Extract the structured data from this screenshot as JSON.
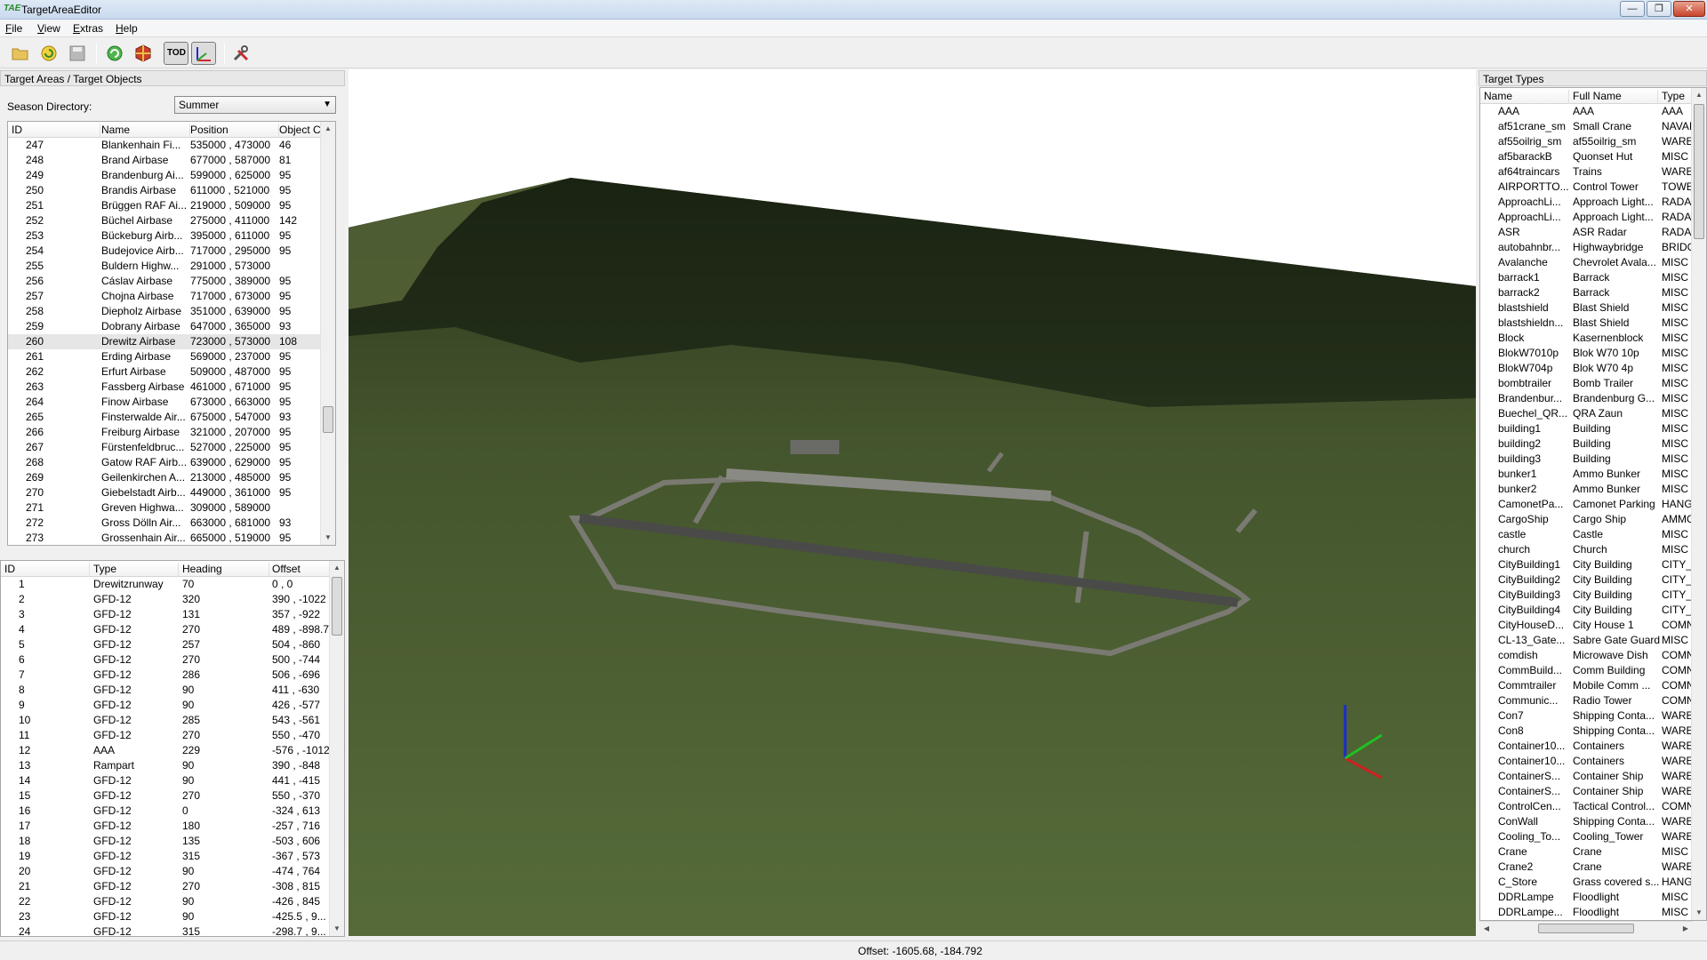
{
  "window": {
    "app_icon_text": "TAE",
    "title": "TargetAreaEditor",
    "minimize": "—",
    "maximize": "❐",
    "close": "✕"
  },
  "menu": [
    {
      "accel": "F",
      "rest": "ile"
    },
    {
      "accel": "V",
      "rest": "iew"
    },
    {
      "accel": "E",
      "rest": "xtras"
    },
    {
      "accel": "H",
      "rest": "elp"
    }
  ],
  "toolbar": {
    "open_icon": "folder-open-icon",
    "reload_icon": "reload-icon",
    "save_icon": "save-icon",
    "refresh_icon": "refresh-icon",
    "objects_icon": "cube-icon",
    "tod_label": "TOD",
    "axes_icon": "axes-icon",
    "tools_icon": "tools-icon"
  },
  "left_panel": {
    "header": "Target Areas / Target Objects",
    "season_label": "Season Directory:",
    "season_value": "Summer",
    "areas_columns": [
      "ID",
      "Name",
      "Position",
      "Object C"
    ],
    "areas": [
      [
        "247",
        "Blankenhain  Fi...",
        "535000 , 473000",
        "46"
      ],
      [
        "248",
        "Brand Airbase",
        "677000 , 587000",
        "81"
      ],
      [
        "249",
        "Brandenburg Ai...",
        "599000 , 625000",
        "95"
      ],
      [
        "250",
        "Brandis Airbase",
        "611000 , 521000",
        "95"
      ],
      [
        "251",
        "Brüggen RAF Ai...",
        "219000 , 509000",
        "95"
      ],
      [
        "252",
        "Büchel Airbase",
        "275000 , 411000",
        "142"
      ],
      [
        "253",
        "Bückeburg Airb...",
        "395000 , 611000",
        "95"
      ],
      [
        "254",
        "Budejovice Airb...",
        "717000 , 295000",
        "95"
      ],
      [
        "255",
        "Buldern Highw...",
        "291000 , 573000",
        ""
      ],
      [
        "256",
        "Cáslav Airbase",
        "775000 , 389000",
        "95"
      ],
      [
        "257",
        "Chojna Airbase",
        "717000 , 673000",
        "95"
      ],
      [
        "258",
        "Diepholz Airbase",
        "351000 , 639000",
        "95"
      ],
      [
        "259",
        "Dobrany Airbase",
        "647000 , 365000",
        "93"
      ],
      [
        "260",
        "Drewitz Airbase",
        "723000 , 573000",
        "108"
      ],
      [
        "261",
        "Erding Airbase",
        "569000 , 237000",
        "95"
      ],
      [
        "262",
        "Erfurt Airbase",
        "509000 , 487000",
        "95"
      ],
      [
        "263",
        "Fassberg Airbase",
        "461000 , 671000",
        "95"
      ],
      [
        "264",
        "Finow Airbase",
        "673000 , 663000",
        "95"
      ],
      [
        "265",
        "Finsterwalde Air...",
        "675000 , 547000",
        "93"
      ],
      [
        "266",
        "Freiburg Airbase",
        "321000 , 207000",
        "95"
      ],
      [
        "267",
        "Fürstenfeldbruc...",
        "527000 , 225000",
        "95"
      ],
      [
        "268",
        "Gatow RAF Airb...",
        "639000 , 629000",
        "95"
      ],
      [
        "269",
        "Geilenkirchen A...",
        "213000 , 485000",
        "95"
      ],
      [
        "270",
        "Giebelstadt Airb...",
        "449000 , 361000",
        "95"
      ],
      [
        "271",
        "Greven Highwa...",
        "309000 , 589000",
        ""
      ],
      [
        "272",
        "Gross Dölln Air...",
        "663000 , 681000",
        "93"
      ],
      [
        "273",
        "Grossenhain Air...",
        "665000 , 519000",
        "95"
      ]
    ],
    "objects_columns": [
      "ID",
      "Type",
      "Heading",
      "Offset"
    ],
    "objects": [
      [
        "1",
        "Drewitzrunway",
        "70",
        "0 , 0"
      ],
      [
        "2",
        "GFD-12",
        "320",
        "390 , -1022"
      ],
      [
        "3",
        "GFD-12",
        "131",
        "357 , -922"
      ],
      [
        "4",
        "GFD-12",
        "270",
        "489 , -898.7"
      ],
      [
        "5",
        "GFD-12",
        "257",
        "504 , -860"
      ],
      [
        "6",
        "GFD-12",
        "270",
        "500 , -744"
      ],
      [
        "7",
        "GFD-12",
        "286",
        "506 , -696"
      ],
      [
        "8",
        "GFD-12",
        "90",
        "411 , -630"
      ],
      [
        "9",
        "GFD-12",
        "90",
        "426 , -577"
      ],
      [
        "10",
        "GFD-12",
        "285",
        "543 , -561"
      ],
      [
        "11",
        "GFD-12",
        "270",
        "550 , -470"
      ],
      [
        "12",
        "AAA",
        "229",
        "-576 , -1012"
      ],
      [
        "13",
        "Rampart",
        "90",
        "390 , -848"
      ],
      [
        "14",
        "GFD-12",
        "90",
        "441 , -415"
      ],
      [
        "15",
        "GFD-12",
        "270",
        "550 , -370"
      ],
      [
        "16",
        "GFD-12",
        "0",
        "-324 , 613"
      ],
      [
        "17",
        "GFD-12",
        "180",
        "-257 , 716"
      ],
      [
        "18",
        "GFD-12",
        "135",
        "-503 , 606"
      ],
      [
        "19",
        "GFD-12",
        "315",
        "-367 , 573"
      ],
      [
        "20",
        "GFD-12",
        "90",
        "-474 , 764"
      ],
      [
        "21",
        "GFD-12",
        "270",
        "-308 , 815"
      ],
      [
        "22",
        "GFD-12",
        "90",
        "-426 , 845"
      ],
      [
        "23",
        "GFD-12",
        "90",
        "-425.5 , 9..."
      ],
      [
        "24",
        "GFD-12",
        "315",
        "-298.7 , 9..."
      ]
    ]
  },
  "right_panel": {
    "header": "Target Types",
    "columns": [
      "Name",
      "Full Name",
      "Type"
    ],
    "types": [
      [
        "AAA",
        "AAA",
        "AAA"
      ],
      [
        "af51crane_sm",
        "Small Crane",
        "NAVAI"
      ],
      [
        "af55oilrig_sm",
        "af55oilrig_sm",
        "WAREI"
      ],
      [
        "af5barackB",
        "Quonset Hut",
        "MISC"
      ],
      [
        "af64traincars",
        "Trains",
        "WAREI"
      ],
      [
        "AIRPORTTO...",
        "Control Tower",
        "TOWE"
      ],
      [
        "ApproachLi...",
        "Approach Light...",
        "RADAI"
      ],
      [
        "ApproachLi...",
        "Approach Light...",
        "RADAI"
      ],
      [
        "ASR",
        "ASR Radar",
        "RADAI"
      ],
      [
        "autobahnbr...",
        "Highwaybridge",
        "BRIDG"
      ],
      [
        "Avalanche",
        "Chevrolet Avala...",
        "MISC"
      ],
      [
        "barrack1",
        "Barrack",
        "MISC"
      ],
      [
        "barrack2",
        "Barrack",
        "MISC"
      ],
      [
        "blastshield",
        "Blast Shield",
        "MISC"
      ],
      [
        "blastshieldn...",
        "Blast Shield",
        "MISC"
      ],
      [
        "Block",
        "Kasernenblock",
        "MISC"
      ],
      [
        "BlokW7010p",
        "Blok W70 10p",
        "MISC"
      ],
      [
        "BlokW704p",
        "Blok W70 4p",
        "MISC"
      ],
      [
        "bombtrailer",
        "Bomb Trailer",
        "MISC"
      ],
      [
        "Brandenbur...",
        "Brandenburg G...",
        "MISC"
      ],
      [
        "Buechel_QR...",
        "QRA Zaun",
        "MISC"
      ],
      [
        "building1",
        "Building",
        "MISC"
      ],
      [
        "building2",
        "Building",
        "MISC"
      ],
      [
        "building3",
        "Building",
        "MISC"
      ],
      [
        "bunker1",
        "Ammo Bunker",
        "MISC"
      ],
      [
        "bunker2",
        "Ammo Bunker",
        "MISC"
      ],
      [
        "CamonetPa...",
        "Camonet Parking",
        "HANG"
      ],
      [
        "CargoShip",
        "Cargo Ship",
        "AMMC"
      ],
      [
        "castle",
        "Castle",
        "MISC"
      ],
      [
        "church",
        "Church",
        "MISC"
      ],
      [
        "CityBuilding1",
        "City Building",
        "CITY_E"
      ],
      [
        "CityBuilding2",
        "City Building",
        "CITY_E"
      ],
      [
        "CityBuilding3",
        "City Building",
        "CITY_E"
      ],
      [
        "CityBuilding4",
        "City Building",
        "CITY_E"
      ],
      [
        "CityHouseD...",
        "City House 1",
        "COMN"
      ],
      [
        "CL-13_Gate...",
        "Sabre Gate Guard",
        "MISC"
      ],
      [
        "comdish",
        "Microwave Dish",
        "COMN"
      ],
      [
        "CommBuild...",
        "Comm Building",
        "COMN"
      ],
      [
        "Commtrailer",
        "Mobile Comm ...",
        "COMN"
      ],
      [
        "Communic...",
        "Radio Tower",
        "COMN"
      ],
      [
        "Con7",
        "Shipping Conta...",
        "WAREI"
      ],
      [
        "Con8",
        "Shipping Conta...",
        "WAREI"
      ],
      [
        "Container10...",
        "Containers",
        "WAREI"
      ],
      [
        "Container10...",
        "Containers",
        "WAREI"
      ],
      [
        "ContainerS...",
        "Container Ship",
        "WAREI"
      ],
      [
        "ContainerS...",
        "Container Ship",
        "WAREI"
      ],
      [
        "ControlCen...",
        "Tactical Control...",
        "COMN"
      ],
      [
        "ConWall",
        "Shipping Conta...",
        "WAREI"
      ],
      [
        "Cooling_To...",
        "Cooling_Tower",
        "WAREI"
      ],
      [
        "Crane",
        "Crane",
        "MISC"
      ],
      [
        "Crane2",
        "Crane",
        "WAREI"
      ],
      [
        "C_Store",
        "Grass covered s...",
        "HANG"
      ],
      [
        "DDRLampe",
        "Floodlight",
        "MISC"
      ],
      [
        "DDRLampe...",
        "Floodlight",
        "MISC"
      ]
    ]
  },
  "status": {
    "text": "Offset: -1605.68, -184.792"
  }
}
